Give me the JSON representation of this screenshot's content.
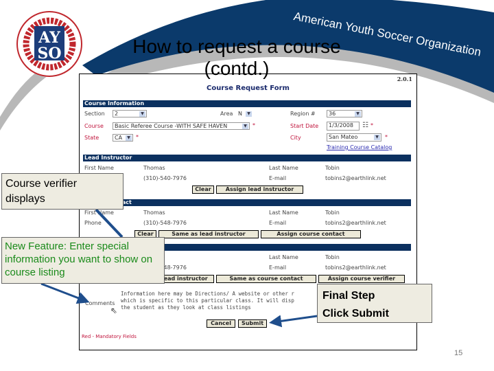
{
  "slide": {
    "title_line1": "How to request a course",
    "title_line2": "(contd.)",
    "org_name": "American Youth Soccer Organization",
    "logo_text": "AYSO",
    "logo_ring_text": "AMERICAN YOUTH SOCCER ORGANIZATION FOUNDED 1964",
    "page_number": "15",
    "colors": {
      "brand_blue": "#0b3a6b",
      "swoosh_gray": "#b8b8b8",
      "logo_red": "#c0272d"
    }
  },
  "form": {
    "version": "2.0.1",
    "title": "Course Request Form",
    "course_information": {
      "header": "Course Information",
      "section_label": "Section",
      "section_value": "2",
      "area_label": "Area",
      "area_value": "N",
      "region_label": "Region #",
      "region_value": "36",
      "course_label": "Course",
      "course_value": "Basic Referee Course -WITH SAFE HAVEN",
      "start_date_label": "Start Date",
      "start_date_value": "1/3/2008",
      "state_label": "State",
      "state_value": "CA",
      "city_label": "City",
      "city_value": "San Mateo",
      "required_mark": "*",
      "catalog_link": "Training Course Catalog"
    },
    "lead_instructor": {
      "header": "Lead Instructor",
      "first_name_label": "First Name",
      "first_name": "Thomas",
      "last_name_label": "Last Name",
      "last_name": "Tobin",
      "phone": "(310)-540-7976",
      "email_label": "E-mail",
      "email": "tobins2@earthlink.net",
      "clear": "Clear",
      "assign": "Assign lead instructor"
    },
    "course_contact": {
      "header": "Course Contact",
      "first_name_label": "First Name",
      "first_name": "Thomas",
      "last_name_label": "Last Name",
      "last_name": "Tobin",
      "phone_label": "Phone",
      "phone": "(310)-548-7976",
      "email_label": "E-mail",
      "email": "tobins2@earthlink.net",
      "clear": "Clear",
      "same": "Same as lead instructor",
      "assign": "Assign course contact"
    },
    "course_verifier": {
      "header": "Course Verifier",
      "last_name_label": "Last Name",
      "last_name": "Tobin",
      "phone": "(310)-548-7976",
      "email_label": "E-mail",
      "email": "tobins2@earthlink.net",
      "same_lead": "Same as lead instructor",
      "same_contact": "Same as course contact",
      "assign": "Assign course verifier"
    },
    "comments_label": "Comments",
    "comments_value": "Information here may be Directions/ A website or other r\nwhich is specific to this particular class. It will disp\nthe student as they look at class listings",
    "cancel": "Cancel",
    "submit": "Submit",
    "mandatory_note": "Red - Mandatory Fields"
  },
  "callouts": {
    "verifier": "Course verifier displays",
    "feature": "New Feature: Enter special information you want to show on course listing",
    "final_step": "Final Step",
    "click_submit": "Click Submit"
  }
}
